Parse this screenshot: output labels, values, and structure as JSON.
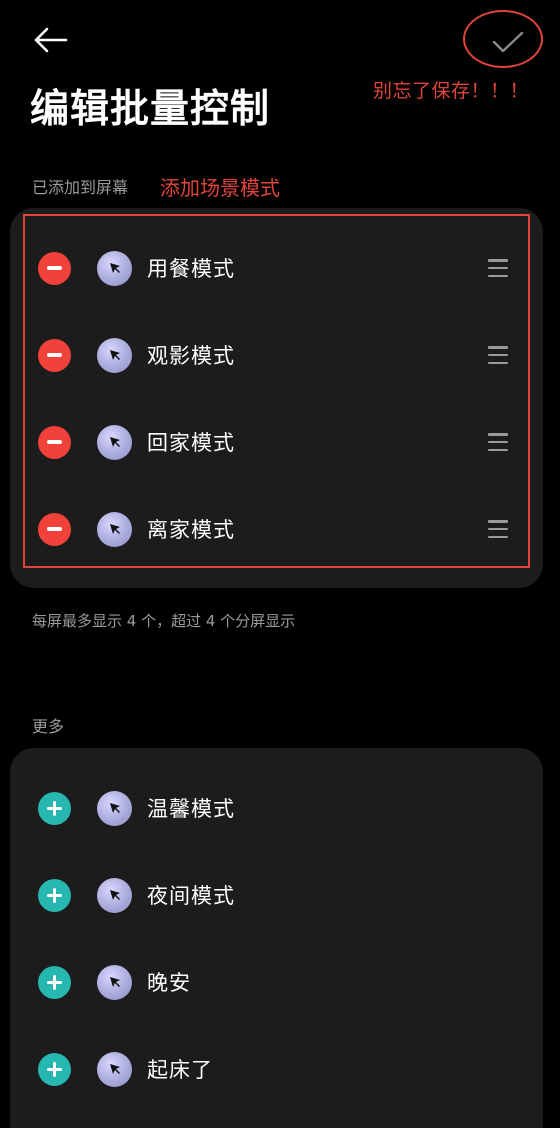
{
  "header": {
    "back_icon": "arrow-left-icon",
    "save_icon": "checkmark-icon",
    "title": "编辑批量控制"
  },
  "annotations": {
    "save_reminder": "别忘了保存！！！",
    "add_scene_note": "添加场景模式",
    "accent_color": "#e0443a"
  },
  "added_section": {
    "label": "已添加到屏幕",
    "items": [
      {
        "label": "用餐模式",
        "action_icon": "remove-icon",
        "scene_icon": "cursor-arrow-icon",
        "handle_icon": "drag-handle-icon"
      },
      {
        "label": "观影模式",
        "action_icon": "remove-icon",
        "scene_icon": "cursor-arrow-icon",
        "handle_icon": "drag-handle-icon"
      },
      {
        "label": "回家模式",
        "action_icon": "remove-icon",
        "scene_icon": "cursor-arrow-icon",
        "handle_icon": "drag-handle-icon"
      },
      {
        "label": "离家模式",
        "action_icon": "remove-icon",
        "scene_icon": "cursor-arrow-icon",
        "handle_icon": "drag-handle-icon"
      }
    ],
    "hint": "每屏最多显示 4 个，超过 4 个分屏显示"
  },
  "more_section": {
    "label": "更多",
    "items": [
      {
        "label": "温馨模式",
        "action_icon": "add-icon",
        "scene_icon": "cursor-arrow-icon"
      },
      {
        "label": "夜间模式",
        "action_icon": "add-icon",
        "scene_icon": "cursor-arrow-icon"
      },
      {
        "label": "晚安",
        "action_icon": "add-icon",
        "scene_icon": "cursor-arrow-icon"
      },
      {
        "label": "起床了",
        "action_icon": "add-icon",
        "scene_icon": "cursor-arrow-icon"
      }
    ]
  },
  "colors": {
    "background": "#000000",
    "card": "#1c1c1c",
    "remove": "#f0413a",
    "add": "#26b7b0",
    "secondary_text": "#9a9a9a"
  }
}
